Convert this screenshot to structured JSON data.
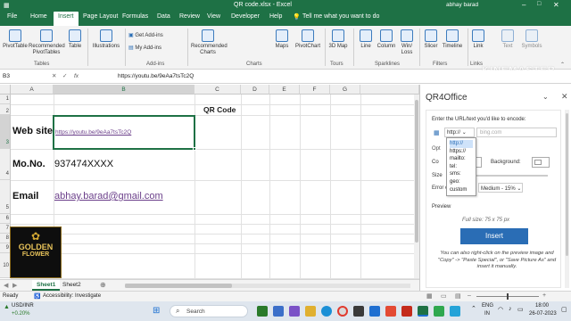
{
  "window": {
    "title": "QR code.xlsx  -  Excel",
    "user": "abhay barad"
  },
  "menu": [
    "File",
    "Home",
    "Insert",
    "Page Layout",
    "Formulas",
    "Data",
    "Review",
    "View",
    "Developer",
    "Help"
  ],
  "tell_me": "Tell me what you want to do",
  "ribbon": {
    "buttons": [
      "PivotTable",
      "Recommended PivotTables",
      "Table",
      "Illustrations",
      "Get Add-ins",
      "My Add-ins",
      "Recommended Charts",
      "Maps",
      "PivotChart",
      "3D Map",
      "Line",
      "Column",
      "Win/ Loss",
      "Slicer",
      "Timeline",
      "Link",
      "Text",
      "Symbols"
    ],
    "groups": [
      "Tables",
      "Add-ins",
      "Charts",
      "Tours",
      "Sparklines",
      "Filters",
      "Links"
    ]
  },
  "watermark": "KINEMASTER",
  "formula_bar": {
    "name_box": "B3",
    "fx": "fx",
    "value": "https://youtu.be/9eAa7tsTc2Q"
  },
  "columns": [
    "A",
    "B",
    "C",
    "D",
    "E",
    "F",
    "G"
  ],
  "rows": [
    "1",
    "2",
    "3",
    "4",
    "5",
    "6",
    "7",
    "8",
    "9",
    "10"
  ],
  "cells": {
    "qr_header": "QR Code",
    "website_label": "Web site",
    "website_value": "https://youtu.be/9eAa7tsTc2Q",
    "mono_label": "Mo.No.",
    "mono_value": "937474XXXX",
    "email_label": "Email",
    "email_value": "abhay.barad@gmail.com"
  },
  "logo": {
    "line1": "GOLDEN",
    "line2": "FLOWER"
  },
  "pane": {
    "title": "QR4Office",
    "prompt": "Enter the URL/text you'd like to encode:",
    "protocol": "http://",
    "placeholder": "bing.com",
    "dropdown": [
      "http://",
      "https://",
      "mailto:",
      "tel:",
      "sms:",
      "geo:",
      "custom"
    ],
    "options_label": "Opt",
    "color_label": "Co",
    "background_label": "Background:",
    "size_label": "Size",
    "error_label": "Error correction:",
    "error_value": "Medium - 15%",
    "preview_label": "Preview",
    "full_size": "Full size: 75 x 75 px",
    "insert_button": "Insert",
    "hint": "You can also right-click on the preview image and \"Copy\" -> \"Paste Special\", or \"Save Picture As\" and insert it manually."
  },
  "sheets": [
    "Sheet1",
    "Sheet2"
  ],
  "status": {
    "ready": "Ready",
    "accessibility": "Accessibility: Investigate"
  },
  "taskbar": {
    "ticker": "USD/INR",
    "change": "+0.20%",
    "search": "Search",
    "lang1": "ENG",
    "lang2": "IN",
    "time": "18:00",
    "date": "26-07-2023"
  },
  "colors": {
    "excel_green": "#1e7145",
    "insert_blue": "#2a6db5",
    "link_purple": "#6b3f8a"
  }
}
